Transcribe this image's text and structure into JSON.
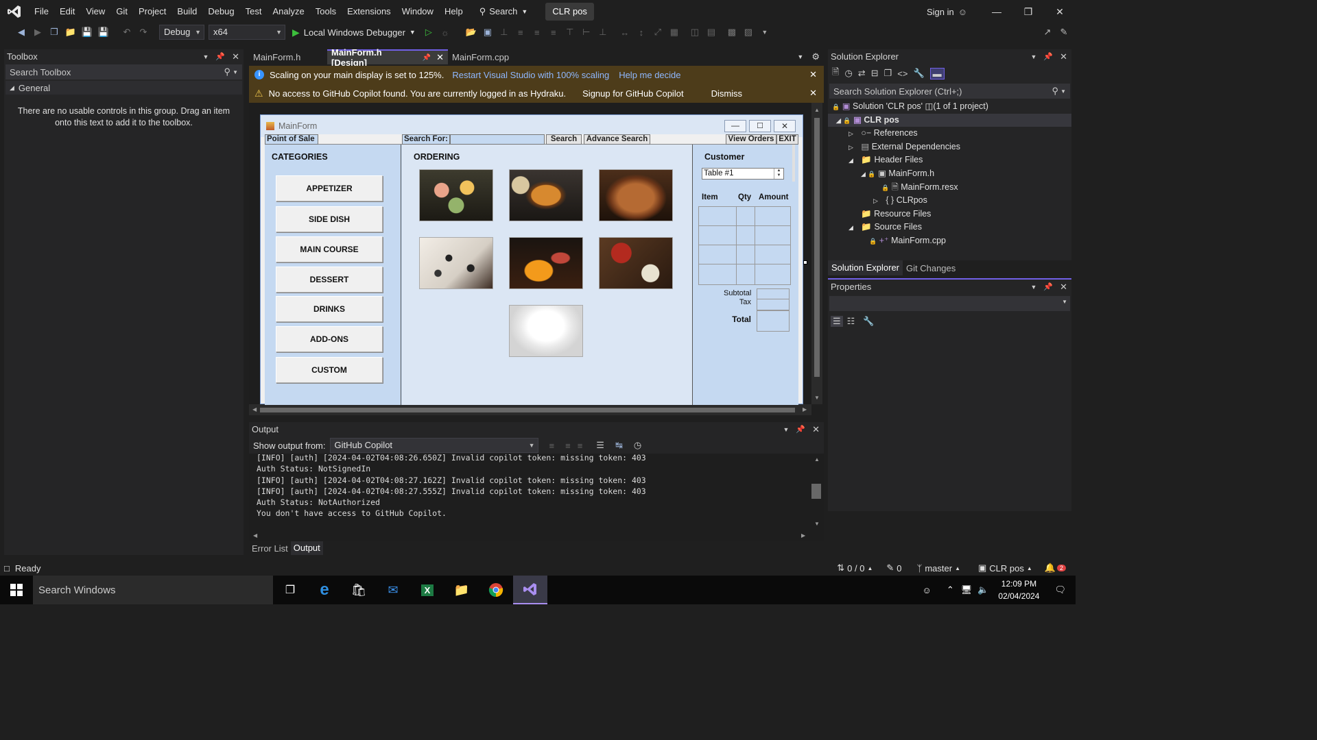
{
  "menubar": {
    "items": [
      "File",
      "Edit",
      "View",
      "Git",
      "Project",
      "Build",
      "Debug",
      "Test",
      "Analyze",
      "Tools",
      "Extensions",
      "Window",
      "Help"
    ],
    "search_label": "Search",
    "solution_badge": "CLR pos",
    "sign_in": "Sign in"
  },
  "toolbar": {
    "config": "Debug",
    "platform": "x64",
    "debugger": "Local Windows Debugger"
  },
  "toolbox": {
    "title": "Toolbox",
    "search_placeholder": "Search Toolbox",
    "group": "General",
    "empty_message": "There are no usable controls in this group. Drag an item onto this text to add it to the toolbox."
  },
  "tabs": [
    {
      "label": "MainForm.h",
      "active": false
    },
    {
      "label": "MainForm.h [Design]",
      "active": true
    },
    {
      "label": "MainForm.cpp",
      "active": false
    }
  ],
  "infobars": {
    "scaling_text": "Scaling on your main display is set to 125%.",
    "scaling_link1": "Restart Visual Studio with 100% scaling",
    "scaling_link2": "Help me decide",
    "copilot_text": "No access to GitHub Copilot found. You are currently logged in as Hydraku.",
    "copilot_link": "Signup for GitHub Copilot",
    "copilot_dismiss": "Dismiss"
  },
  "form": {
    "title": "MainForm",
    "menu": {
      "point_of_sale": "Point of Sale",
      "search_for": "Search For:",
      "search": "Search",
      "advance_search": "Advance Search",
      "view_orders": "View Orders",
      "exit": "EXIT"
    },
    "categories_label": "CATEGORIES",
    "categories": [
      "APPETIZER",
      "SIDE DISH",
      "MAIN COURSE",
      "DESSERT",
      "DRINKS",
      "ADD-ONS",
      "CUSTOM"
    ],
    "ordering_label": "ORDERING",
    "customer_label": "Customer",
    "table_value": "Table #1",
    "order_columns": [
      "Item",
      "Qty",
      "Amount"
    ],
    "subtotal_label": "Subtotal",
    "tax_label": "Tax",
    "total_label": "Total"
  },
  "output": {
    "title": "Output",
    "show_from_label": "Show output from:",
    "source": "GitHub Copilot",
    "lines": [
      "[INFO] [auth] [2024-04-02T04:08:26.650Z] Invalid copilot token: missing token: 403",
      "Auth Status: NotSignedIn",
      "[INFO] [auth] [2024-04-02T04:08:27.162Z] Invalid copilot token: missing token: 403",
      "[INFO] [auth] [2024-04-02T04:08:27.555Z] Invalid copilot token: missing token: 403",
      "Auth Status: NotAuthorized",
      "You don't have access to GitHub Copilot."
    ],
    "bottom_tabs": [
      "Error List",
      "Output"
    ]
  },
  "solution_explorer": {
    "title": "Solution Explorer",
    "search_placeholder": "Search Solution Explorer (Ctrl+;)",
    "solution": "Solution 'CLR pos' ◫(1 of 1 project)",
    "project": "CLR pos",
    "references": "References",
    "external": "External Dependencies",
    "header_files": "Header Files",
    "mainform_h": "MainForm.h",
    "mainform_resx": "MainForm.resx",
    "clrpos_ns": "CLRpos",
    "resource_files": "Resource Files",
    "source_files": "Source Files",
    "mainform_cpp": "MainForm.cpp",
    "bottom_tabs": [
      "Solution Explorer",
      "Git Changes"
    ]
  },
  "properties": {
    "title": "Properties"
  },
  "statusbar": {
    "ready": "Ready",
    "sync": "0 / 0",
    "edits": "0",
    "branch": "master",
    "repo": "CLR pos",
    "notifications": "2"
  },
  "taskbar": {
    "search_placeholder": "Search Windows",
    "time": "12:09 PM",
    "date": "02/04/2024"
  },
  "colors": {
    "accent": "#7160e8",
    "infobar": "#4d3c1a",
    "form_bg": "#c5d9f1",
    "status_bar": "#1f1f1f",
    "taskbar": "#0a0a0a"
  }
}
